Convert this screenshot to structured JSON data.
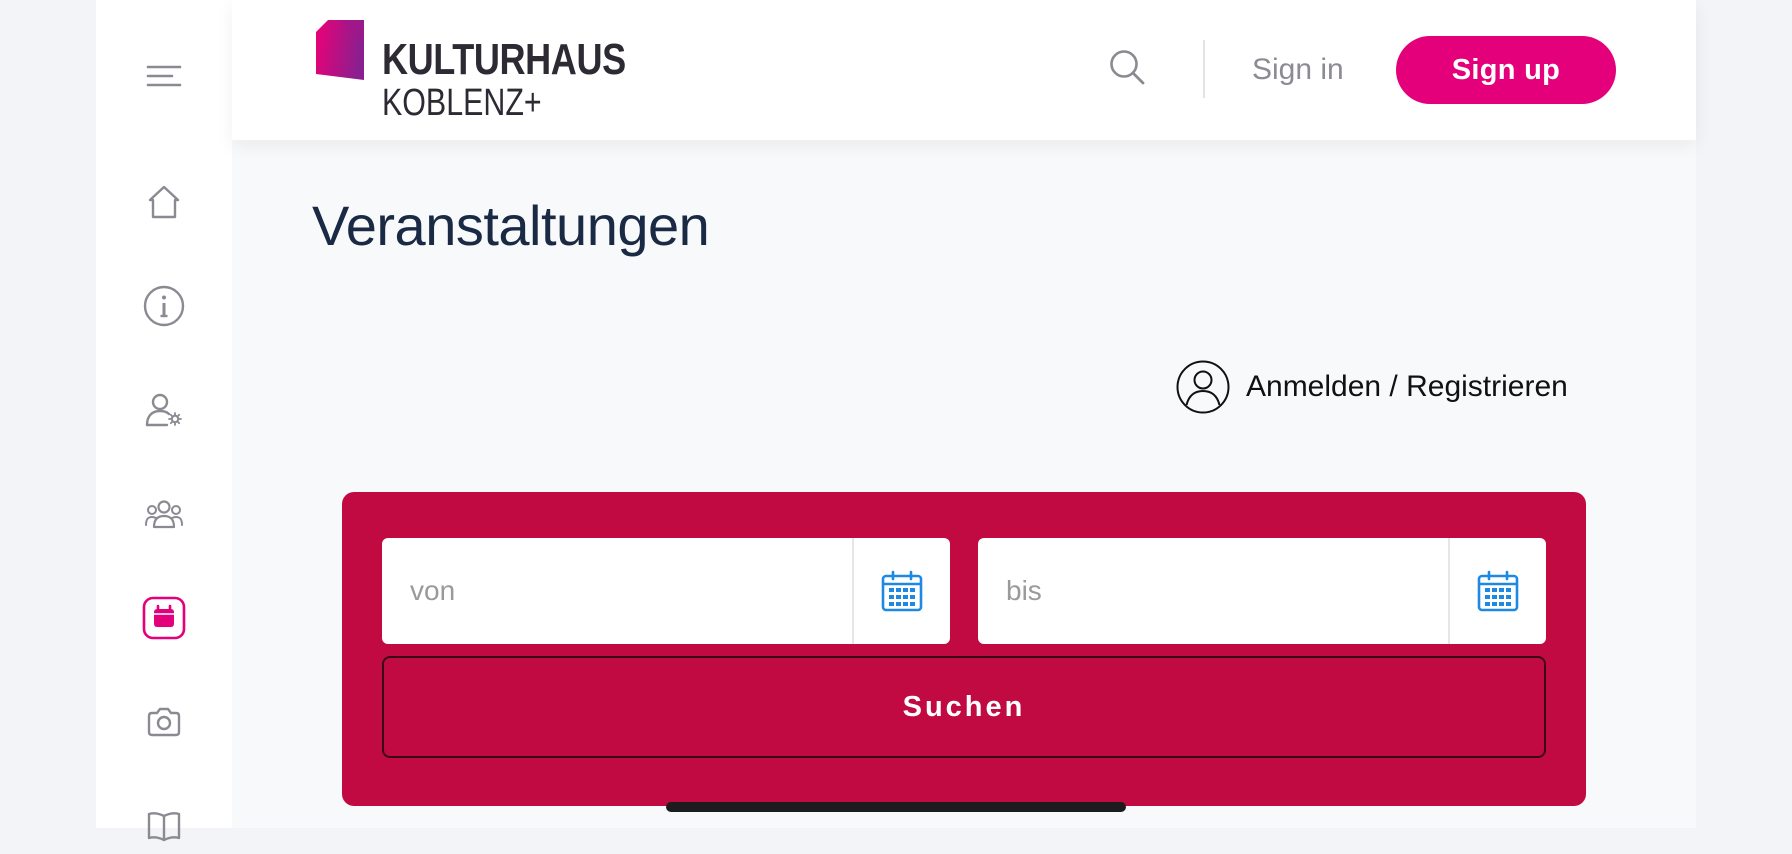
{
  "brand": {
    "line1": "KULTURHAUS",
    "line2": "KOBLENZ+",
    "accent_color": "#e3007a"
  },
  "header": {
    "search_icon": "search-icon",
    "signin_label": "Sign in",
    "signup_label": "Sign up"
  },
  "sidebar": {
    "items": [
      {
        "icon": "menu-icon",
        "active": false
      },
      {
        "icon": "home-icon",
        "active": false
      },
      {
        "icon": "info-icon",
        "active": false
      },
      {
        "icon": "user-settings-icon",
        "active": false
      },
      {
        "icon": "group-icon",
        "active": false
      },
      {
        "icon": "calendar-icon",
        "active": true
      },
      {
        "icon": "camera-icon",
        "active": false
      },
      {
        "icon": "book-icon",
        "active": false
      }
    ]
  },
  "main": {
    "title": "Veranstaltungen",
    "login_label": "Anmelden / Registrieren",
    "search": {
      "from_placeholder": "von",
      "to_placeholder": "bis",
      "submit_label": "Suchen",
      "card_color": "#c20a42"
    }
  }
}
